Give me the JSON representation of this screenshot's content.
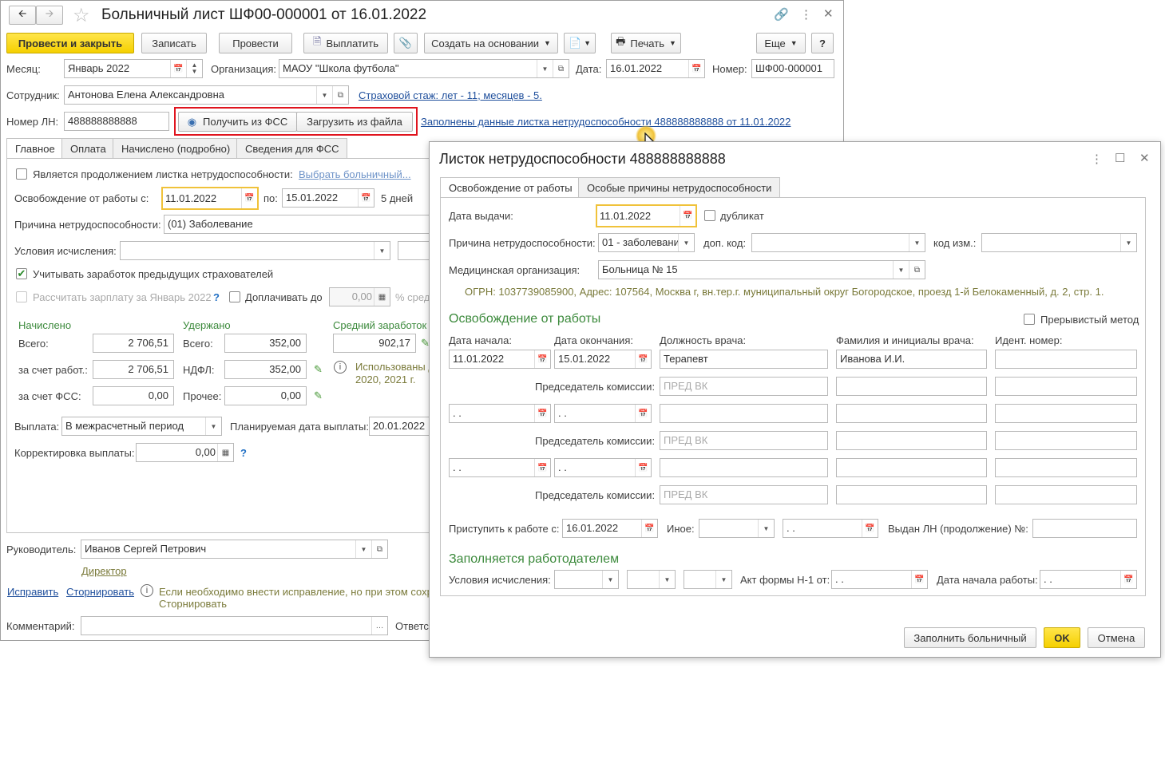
{
  "main": {
    "title": "Больничный лист ШФ00-000001 от 16.01.2022",
    "toolbar": {
      "post_close": "Провести и закрыть",
      "save": "Записать",
      "post": "Провести",
      "pay": "Выплатить",
      "create_based": "Создать на основании",
      "print": "Печать",
      "more": "Еще",
      "help": "?"
    },
    "month_label": "Месяц:",
    "month_value": "Январь 2022",
    "org_label": "Организация:",
    "org_value": "МАОУ \"Школа футбола\"",
    "date_label": "Дата:",
    "date_value": "16.01.2022",
    "number_label": "Номер:",
    "number_value": "ШФ00-000001",
    "employee_label": "Сотрудник:",
    "employee_value": "Антонова Елена Александровна",
    "insurance_link": "Страховой стаж: лет - 11; месяцев - 5.",
    "ln_label": "Номер ЛН:",
    "ln_value": "488888888888",
    "get_fss": "Получить из ФСС",
    "load_file": "Загрузить из файла",
    "filled_link": "Заполнены данные листка нетрудоспособности 488888888888 от 11.01.2022",
    "tabs": [
      "Главное",
      "Оплата",
      "Начислено (подробно)",
      "Сведения для ФСС"
    ],
    "continuation_label": "Является продолжением листка нетрудоспособности:",
    "choose_link": "Выбрать больничный...",
    "release_label": "Освобождение от работы с:",
    "release_from": "11.01.2022",
    "po_label": "по:",
    "release_to": "15.01.2022",
    "days": "5 дней",
    "cause_label": "Причина нетрудоспособности:",
    "cause_value": "(01) Заболевание",
    "conditions_label": "Условия исчисления:",
    "prev_insurers_label": "Учитывать заработок предыдущих страхователей",
    "calc_salary_label": "Рассчитать зарплату за Январь 2022",
    "q": "?",
    "surcharge_label": "Доплачивать до",
    "surcharge_value": "0,00",
    "surcharge_suffix": "% сред",
    "accrued_header": "Начислено",
    "withheld_header": "Удержано",
    "avg_header": "Средний заработок",
    "total_label": "Всего:",
    "total_accrued": "2 706,51",
    "total_withheld_label": "Всего:",
    "total_withheld": "352,00",
    "avg_value": "902,17",
    "employer_label": "за счет работ.:",
    "employer_value": "2 706,51",
    "ndfl_label": "НДФЛ:",
    "ndfl_value": "352,00",
    "used_text_1": "Использованы д",
    "used_text_2": "2020,  2021 г.",
    "fss_label": "за счет ФСС:",
    "fss_value": "0,00",
    "other_label": "Прочее:",
    "other_value": "0,00",
    "payout_label": "Выплата:",
    "payout_value": "В межрасчетный период",
    "planned_label": "Планируемая дата выплаты:",
    "planned_value": "20.01.2022",
    "correction_label": "Корректировка выплаты:",
    "correction_value": "0,00",
    "head_label": "Руководитель:",
    "head_value": "Иванов Сергей Петрович",
    "director_link": "Директор",
    "fix_link": "Исправить",
    "reverse_link": "Сторнировать",
    "hint_1": "Если необходимо внести исправление, но при этом сохр",
    "hint_2": "Сторнировать",
    "comment_label": "Комментарий:",
    "responsible_label": "Ответст"
  },
  "dialog": {
    "title": "Листок нетрудоспособности 488888888888",
    "tabs": [
      "Освобождение от работы",
      "Особые причины нетрудоспособности"
    ],
    "issue_date_label": "Дата выдачи:",
    "issue_date": "11.01.2022",
    "duplicate_label": "дубликат",
    "cause_label": "Причина нетрудоспособности:",
    "cause_value": "01 - заболевани",
    "extra_code_label": "доп. код:",
    "change_code_label": "код изм.:",
    "med_org_label": "Медицинская организация:",
    "med_org_value": "Больница № 15",
    "ogrn_text": "ОГРН: 1037739085900, Адрес: 107564, Москва г, вн.тер.г. муниципальный округ Богородское, проезд 1-й Белокаменный, д. 2, стр. 1.",
    "release_section": "Освобождение от работы",
    "intermittent_label": "Прерывистый метод",
    "col_start": "Дата начала:",
    "col_end": "Дата окончания:",
    "col_position": "Должность врача:",
    "col_name": "Фамилия и инициалы врача:",
    "col_id": "Идент.  номер:",
    "row1_start": "11.01.2022",
    "row1_end": "15.01.2022",
    "row1_position": "Терапевт",
    "row1_name": "Иванова И.И.",
    "empty_date": " .  .",
    "chair_label": "Председатель комиссии:",
    "chair_placeholder": "ПРЕД ВК",
    "return_label": "Приступить к работе с:",
    "return_value": "16.01.2022",
    "other_label": "Иное:",
    "issued_ln_label": "Выдан ЛН (продолжение) №:",
    "employer_section": "Заполняется работодателем",
    "conditions_label": "Условия исчисления:",
    "act_label": "Акт формы Н-1 от:",
    "job_start_label": "Дата начала работы:",
    "fill_button": "Заполнить больничный",
    "ok_button": "OK",
    "cancel_button": "Отмена"
  },
  "colors": {
    "accent_yellow": "#f5d000",
    "link_blue": "#1f4f9c",
    "section_green": "#3c8a3c",
    "highlight_red": "#e0141e"
  }
}
